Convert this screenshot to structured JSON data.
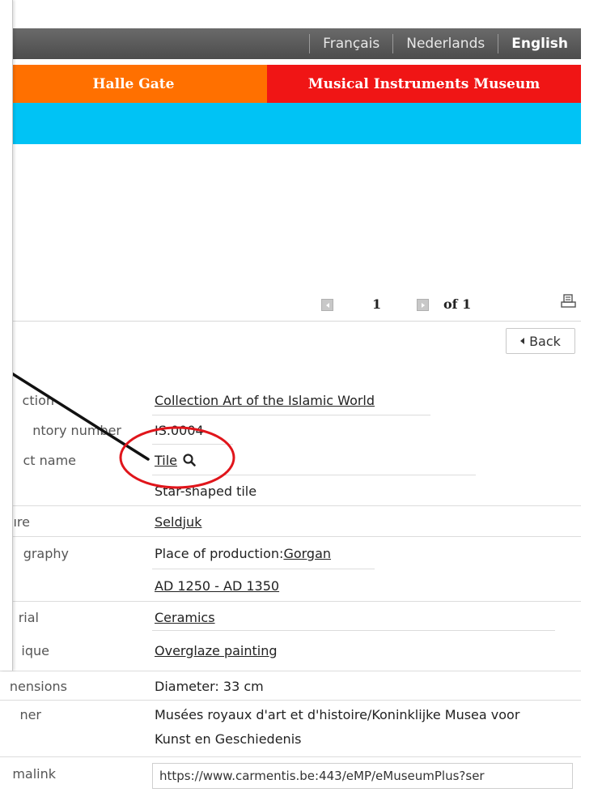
{
  "languages": [
    {
      "label": "Français",
      "active": false
    },
    {
      "label": "Nederlands",
      "active": false
    },
    {
      "label": "English",
      "active": true
    }
  ],
  "museums": [
    {
      "label": "Halle Gate",
      "color": "#ff7000"
    },
    {
      "label": "Musical Instruments Museum",
      "color": "#f01515"
    }
  ],
  "accent_bar_color": "#00c3f5",
  "pager": {
    "current": "1",
    "of_label": "of 1"
  },
  "back_label": "Back",
  "details": [
    {
      "label": "ction",
      "value": "Collection Art of the Islamic World",
      "link": true
    },
    {
      "label": "ntory number",
      "value": "IS.0004",
      "link": false
    },
    {
      "label": "ct name",
      "value": "Tile",
      "link": true
    },
    {
      "label": "",
      "value": "Star-shaped tile",
      "link": false
    },
    {
      "label": "ıre",
      "value": "Seldjuk",
      "link": true
    },
    {
      "label": "graphy",
      "value_prefix": "Place of production:",
      "value": "Gorgan",
      "link": true
    },
    {
      "label": "",
      "value": "AD 1250 - AD 1350",
      "link": true
    },
    {
      "label": "rial",
      "value": "Ceramics",
      "link": true
    },
    {
      "label": "ique",
      "value": "Overglaze painting",
      "link": true
    },
    {
      "label": "nensions",
      "value": "Diameter: 33 cm",
      "link": false
    },
    {
      "label": "ner",
      "value": "Musées royaux d'art et d'histoire/Koninklijke Musea voor Kunst en Geschiedenis",
      "link": false
    },
    {
      "label": "malink",
      "value": "https://www.carmentis.be:443/eMP/eMuseumPlus?ser",
      "link": false
    }
  ],
  "annotation_color": "#e0151b"
}
